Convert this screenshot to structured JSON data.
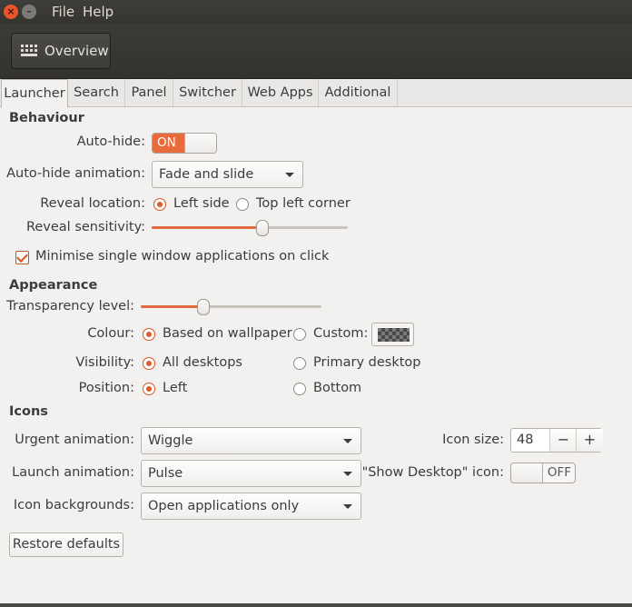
{
  "window": {
    "close_glyph": "×",
    "min_glyph": "–"
  },
  "menubar": {
    "file": "File",
    "help": "Help"
  },
  "toolbar": {
    "overview_label": "Overview"
  },
  "tabs": [
    {
      "label": "Launcher",
      "active": true
    },
    {
      "label": "Search"
    },
    {
      "label": "Panel"
    },
    {
      "label": "Switcher"
    },
    {
      "label": "Web Apps"
    },
    {
      "label": "Additional"
    }
  ],
  "behaviour": {
    "heading": "Behaviour",
    "autohide_label": "Auto-hide:",
    "autohide_state": "ON",
    "autohide_anim_label": "Auto-hide animation:",
    "autohide_anim_value": "Fade and slide",
    "reveal_location_label": "Reveal location:",
    "reveal_left": "Left side",
    "reveal_topleft": "Top left corner",
    "reveal_sensitivity_label": "Reveal sensitivity:",
    "reveal_sensitivity_level": 0.56,
    "minimise_label": "Minimise single window applications on click",
    "minimise_checked": true
  },
  "appearance": {
    "heading": "Appearance",
    "transparency_label": "Transparency level:",
    "transparency_level": 0.34,
    "colour_label": "Colour:",
    "colour_wallpaper": "Based on wallpaper",
    "colour_custom": "Custom:",
    "visibility_label": "Visibility:",
    "visibility_all": "All desktops",
    "visibility_primary": "Primary desktop",
    "position_label": "Position:",
    "position_left": "Left",
    "position_bottom": "Bottom"
  },
  "icons": {
    "heading": "Icons",
    "urgent_label": "Urgent animation:",
    "urgent_value": "Wiggle",
    "launch_label": "Launch animation:",
    "launch_value": "Pulse",
    "backgrounds_label": "Icon backgrounds:",
    "backgrounds_value": "Open applications only",
    "icon_size_label": "Icon size:",
    "icon_size_value": "48",
    "minus": "−",
    "plus": "+",
    "show_desktop_label": "\"Show Desktop\" icon:",
    "show_desktop_state": "OFF"
  },
  "restore_label": "Restore defaults",
  "colors": {
    "accent": "#e96a3a",
    "titlebar": "#3c3b37"
  }
}
